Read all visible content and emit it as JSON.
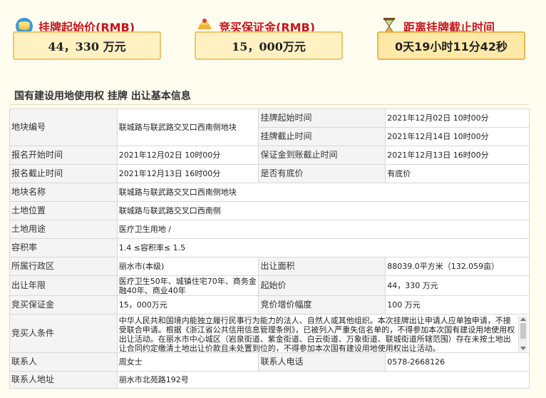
{
  "header": {
    "start_price_label": "挂牌起始价(RMB)",
    "start_price_value": "44，330 万元",
    "deposit_label": "竞买保证金(RMB)",
    "deposit_value": "15，000万元",
    "deadline_label": "距离挂牌截止时间",
    "deadline_value": "0天19小时11分42秒"
  },
  "section_title": "国有建设用地使用权 挂牌 出让基本信息",
  "rows": {
    "parcel_no_k": "地块编号",
    "parcel_no_v": "联城路与联武路交叉口西南侧地块",
    "list_start_k": "挂牌起始时间",
    "list_start_v": "2021年12月02日 10时00分",
    "list_end_k": "挂牌截止时间",
    "list_end_v": "2021年12月14日 10时00分",
    "reg_start_k": "报名开始时间",
    "reg_start_v": "2021年12月02日 10时00分",
    "deposit_deadline_k": "保证金到账截止时间",
    "deposit_deadline_v": "2021年12月13日 16时00分",
    "reg_end_k": "报名截止时间",
    "reg_end_v": "2021年12月13日 16时00分",
    "reserve_k": "是否有底价",
    "reserve_v": "有底价",
    "name_k": "地块名称",
    "name_v": "联城路与联武路交叉口西南侧地块",
    "location_k": "土地位置",
    "location_v": "联城路与联武路交叉口西南侧",
    "use_k": "土地用途",
    "use_v": "医疗卫生用地 /",
    "far_k": "容积率",
    "far_v": "1.4 ≤容积率≤ 1.5",
    "district_k": "所属行政区",
    "district_v": "丽水市(本级)",
    "area_k": "出让面积",
    "area_v": "88039.0平方米（132.059亩）",
    "years_k": "出让年限",
    "years_v": "医疗卫生50年、城镇住宅70年、商务金融40年、商业40年",
    "start_price_k": "起始价",
    "start_price_v": "44，330 万元",
    "bid_deposit_k": "竞买保证金",
    "bid_deposit_v": "15，000万元",
    "increment_k": "竞价增价幅度",
    "increment_v": "100 万元",
    "cond_k": "竞买人条件",
    "cond_v": "中华人民共和国境内能独立履行民事行为能力的法人、自然人或其他组织。本次挂牌出让申请人应单独申请，不接受联合申请。根据《浙江省公共信用信息管理条例》，已被列入严重失信名单的，不得参加本次国有建设用地使用权出让活动。在丽水市中心城区（岩泉街道、紫金街道、白云街道、万象街道、联城街道所辖范围）存在未按土地出让合同约定缴清土地出让价款且未处置到位的，不得参加本次国有建设用地使用权出让活动。",
    "contact_k": "联系人",
    "contact_v": "周女士",
    "phone_k": "联系人电话",
    "phone_v": "0578-2668126",
    "addr_k": "联系人地址",
    "addr_v": "丽水市北苑路192号"
  }
}
